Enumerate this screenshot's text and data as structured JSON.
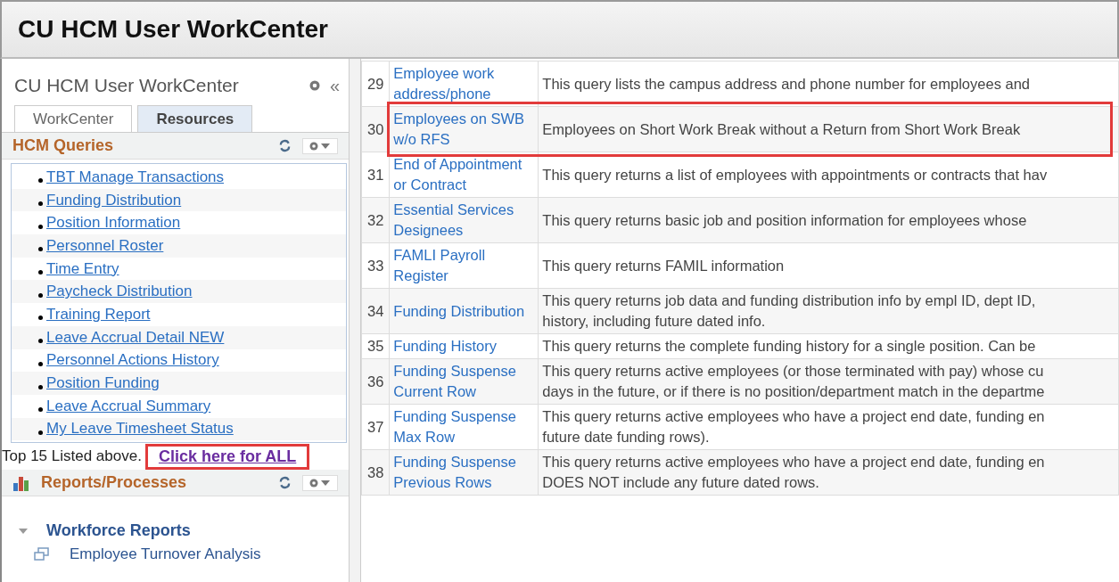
{
  "window": {
    "title": "CU HCM User WorkCenter"
  },
  "sidebar": {
    "title": "CU HCM User WorkCenter",
    "collapse_glyph": "«",
    "tabs": [
      {
        "label": "WorkCenter",
        "selected": false
      },
      {
        "label": "Resources",
        "selected": true
      }
    ],
    "queries": {
      "title": "HCM Queries",
      "items": [
        {
          "label": "TBT Manage Transactions"
        },
        {
          "label": "Funding Distribution"
        },
        {
          "label": "Position Information"
        },
        {
          "label": "Personnel Roster"
        },
        {
          "label": "Time Entry"
        },
        {
          "label": "Paycheck Distribution"
        },
        {
          "label": "Training Report"
        },
        {
          "label": "Leave Accrual Detail NEW"
        },
        {
          "label": "Personnel Actions History"
        },
        {
          "label": "Position Funding"
        },
        {
          "label": "Leave Accrual Summary"
        },
        {
          "label": "My Leave Timesheet Status"
        }
      ],
      "footer_text": "Top 15 Listed above.",
      "footer_link": {
        "label": "Click here for ALL",
        "highlighted": true
      }
    },
    "reports": {
      "title": "Reports/Processes",
      "tree": [
        {
          "label": "Workforce Reports",
          "expanded": true,
          "children": [
            {
              "label": "Employee Turnover Analysis"
            }
          ]
        }
      ]
    }
  },
  "table": {
    "rows": [
      {
        "number": "29",
        "name": "Employee work address/phone",
        "description": [
          "This query lists the campus address and phone number for employees and"
        ],
        "highlighted": false
      },
      {
        "number": "30",
        "name": "Employees on SWB w/o RFS",
        "description": [
          "Employees on Short Work Break without a Return from Short Work Break"
        ],
        "highlighted": true
      },
      {
        "number": "31",
        "name": "End of Appointment or Contract",
        "description": [
          "This query returns a list of employees with appointments or contracts that hav"
        ],
        "highlighted": false
      },
      {
        "number": "32",
        "name": "Essential Services Designees",
        "description": [
          "This query returns basic job and position information for employees whose"
        ],
        "highlighted": false
      },
      {
        "number": "33",
        "name": "FAMLI Payroll Register",
        "description": [
          "This query returns FAMIL information"
        ],
        "highlighted": false
      },
      {
        "number": "34",
        "name": "Funding Distribution",
        "description": [
          "This query returns job data and funding distribution info by empl ID, dept ID,",
          "history, including future dated info."
        ],
        "highlighted": false
      },
      {
        "number": "35",
        "name": "Funding History",
        "description": [
          "This query returns the complete funding history for a single position. Can be"
        ],
        "highlighted": false
      },
      {
        "number": "36",
        "name": "Funding Suspense Current Row",
        "description": [
          "This query returns active employees (or those terminated with pay) whose cu",
          "days in the future, or if there is no position/department match in the departme"
        ],
        "highlighted": false
      },
      {
        "number": "37",
        "name": "Funding Suspense Max Row",
        "description": [
          "This query returns active employees who have a project end date, funding en",
          "future date funding rows)."
        ],
        "highlighted": false
      },
      {
        "number": "38",
        "name": "Funding Suspense Previous Rows",
        "description": [
          "This query returns active employees who have a project end date, funding en",
          "DOES NOT include any future dated rows."
        ],
        "highlighted": false
      }
    ]
  }
}
